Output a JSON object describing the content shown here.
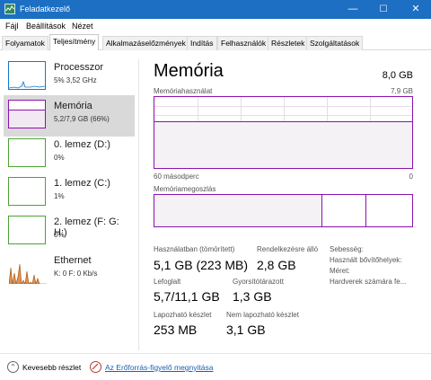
{
  "window": {
    "title": "Feladatkezelő",
    "minimize": "—",
    "maximize": "☐",
    "close": "✕"
  },
  "menu": [
    "Fájl",
    "Beállítások",
    "Nézet"
  ],
  "tabs": [
    "Folyamatok",
    "Teljesítmény",
    "Alkalmazáselőzmények",
    "Indítás",
    "Felhasználók",
    "Részletek",
    "Szolgáltatások"
  ],
  "active_tab": "Teljesítmény",
  "sidebar": [
    {
      "title": "Processzor",
      "sub": "5% 3,52 GHz",
      "color": "#1178c8"
    },
    {
      "title": "Memória",
      "sub": "5,2/7,9 GB (66%)",
      "color": "#8b12ae",
      "usage": 0.66
    },
    {
      "title": "0. lemez (D:)",
      "sub": "0%",
      "color": "#4aa431"
    },
    {
      "title": "1. lemez (C:)",
      "sub": "1%",
      "color": "#4aa431"
    },
    {
      "title": "2. lemez (F: G: H:)",
      "sub": "0%",
      "color": "#4aa431"
    },
    {
      "title": "Ethernet",
      "sub": "K: 0 F: 0 Kb/s",
      "color": "#a74f01"
    }
  ],
  "memory": {
    "heading": "Memória",
    "total": "8,0 GB",
    "usage_label": "Memóriahasználat",
    "usage_max": "7,9 GB",
    "usage_fraction": 0.66,
    "time_left": "60 másodperc",
    "time_right": "0",
    "composition_label": "Memóriamegoszlás",
    "stats": {
      "in_use_label": "Használatban (tömörített)",
      "in_use_value": "5,1 GB (223 MB)",
      "available_label": "Rendelkezésre álló",
      "available_value": "2,8 GB",
      "committed_label": "Lefoglalt",
      "committed_value": "5,7/11,1 GB",
      "cached_label": "Gyorsítótárazott",
      "cached_value": "1,3 GB",
      "paged_label": "Lapozható készlet",
      "paged_value": "253 MB",
      "nonpaged_label": "Nem lapozható készlet",
      "nonpaged_value": "3,1 GB",
      "speed_label": "Sebesség:",
      "slots_label": "Használt bővítőhelyek:",
      "form_label": "Méret:",
      "hw_reserved_label": "Hardverek számára fe..."
    }
  },
  "footer": {
    "fewer_details": "Kevesebb részlet",
    "resmon": "Az Erőforrás-figyelő megnyitása"
  }
}
